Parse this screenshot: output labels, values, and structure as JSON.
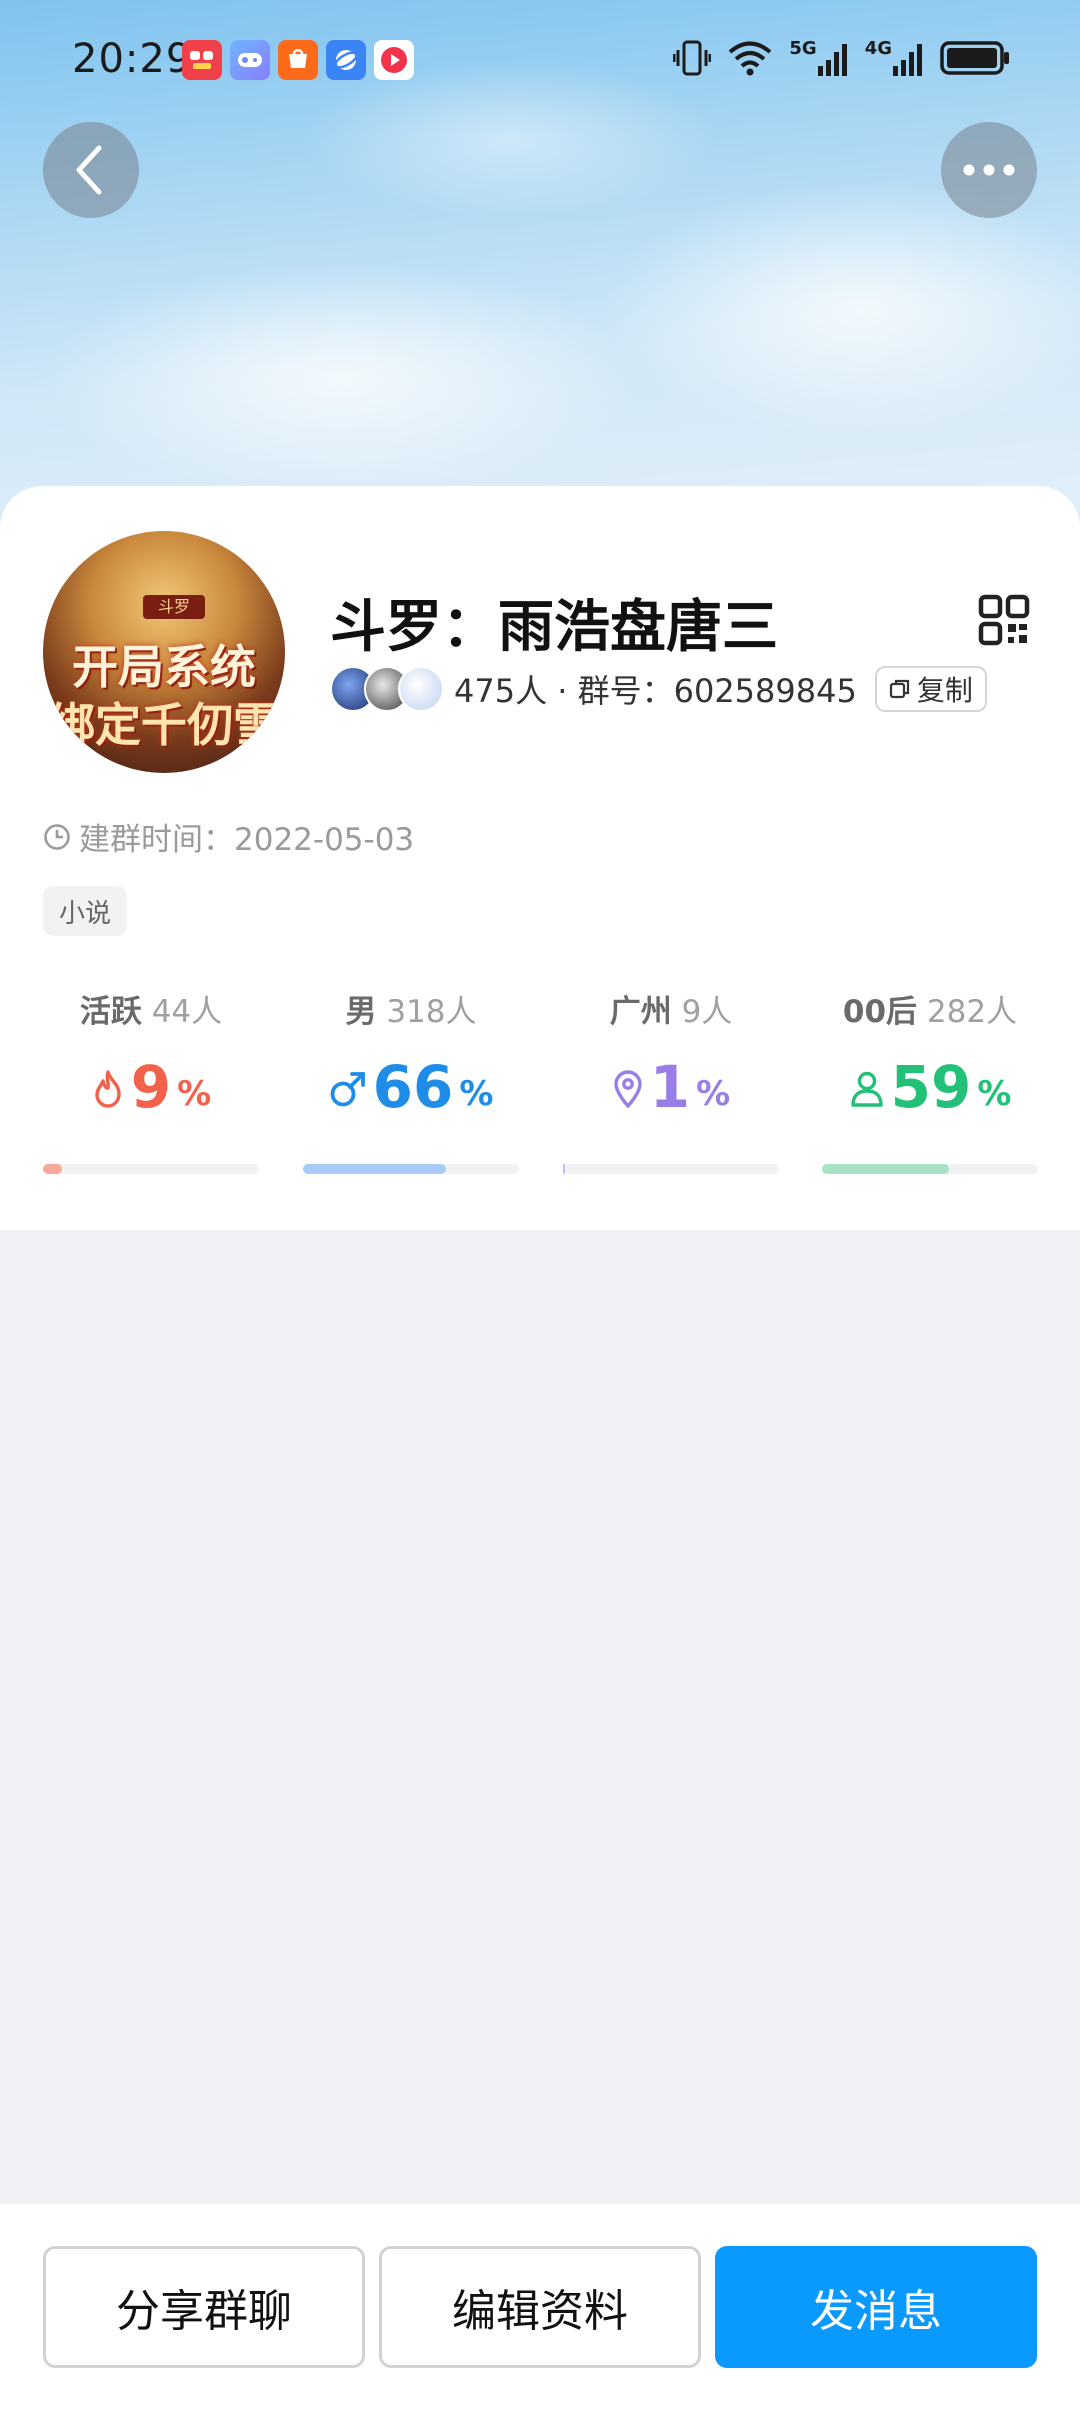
{
  "status_bar": {
    "time": "20:29",
    "network_5g": "5G",
    "network_4g": "4G"
  },
  "header": {
    "back_icon": "chevron-left-icon",
    "more_icon": "more-dots-icon"
  },
  "group": {
    "name": "斗罗：雨浩盘唐三",
    "avatar_banner": "斗罗",
    "avatar_line1": "开局系统",
    "avatar_line2": "绑定千仞雪",
    "member_info": "475人 · 群号：602589845",
    "copy_label": "复制",
    "created_label": "建群时间：2022-05-03",
    "tag": "小说"
  },
  "stats": [
    {
      "label_bold": "活跃",
      "label_rest": "44人",
      "value": "9",
      "unit": "%",
      "percent": 9,
      "color": "#f2614a",
      "bar_color": "#f8a99a",
      "icon": "fire-icon"
    },
    {
      "label_bold": "男",
      "label_rest": "318人",
      "value": "66",
      "unit": "%",
      "percent": 66,
      "color": "#1f8de8",
      "bar_color": "#a6cbf5",
      "icon": "male-icon"
    },
    {
      "label_bold": "广州",
      "label_rest": "9人",
      "value": "1",
      "unit": "%",
      "percent": 1,
      "color": "#9a7ee8",
      "bar_color": "#c7b8f2",
      "icon": "location-pin-icon"
    },
    {
      "label_bold": "00后",
      "label_rest": "282人",
      "value": "59",
      "unit": "%",
      "percent": 59,
      "color": "#22c177",
      "bar_color": "#a7e2c4",
      "icon": "person-icon"
    }
  ],
  "actions": {
    "share": "分享群聊",
    "edit": "编辑资料",
    "message": "发消息"
  },
  "colors": {
    "primary": "#0a99ff"
  }
}
